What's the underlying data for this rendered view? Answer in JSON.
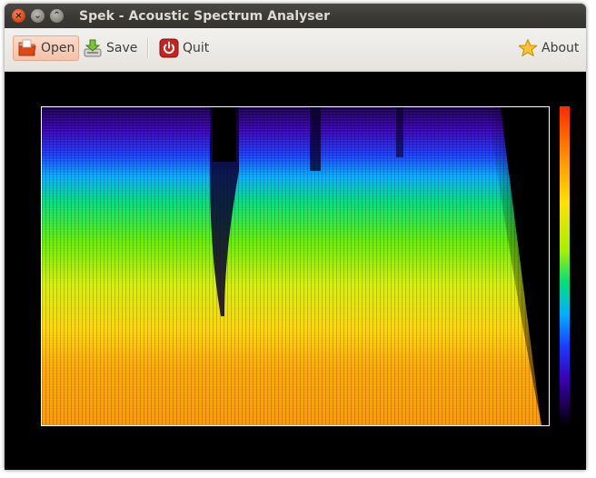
{
  "window": {
    "title": "Spek - Acoustic Spectrum Analyser"
  },
  "toolbar": {
    "open_label": "Open",
    "save_label": "Save",
    "quit_label": "Quit",
    "about_label": "About",
    "icons": {
      "open": "folder-open-icon",
      "save": "save-download-icon",
      "quit": "power-icon",
      "about": "star-icon"
    }
  },
  "spectrogram": {
    "colors": [
      "#000000",
      "#1a0050",
      "#3b00b8",
      "#1a3cff",
      "#00b0ff",
      "#00e07a",
      "#60f000",
      "#d8f000",
      "#ffd500",
      "#ffa800",
      "#ff7a00",
      "#ff2a00"
    ],
    "highlight": "#dd4814"
  }
}
